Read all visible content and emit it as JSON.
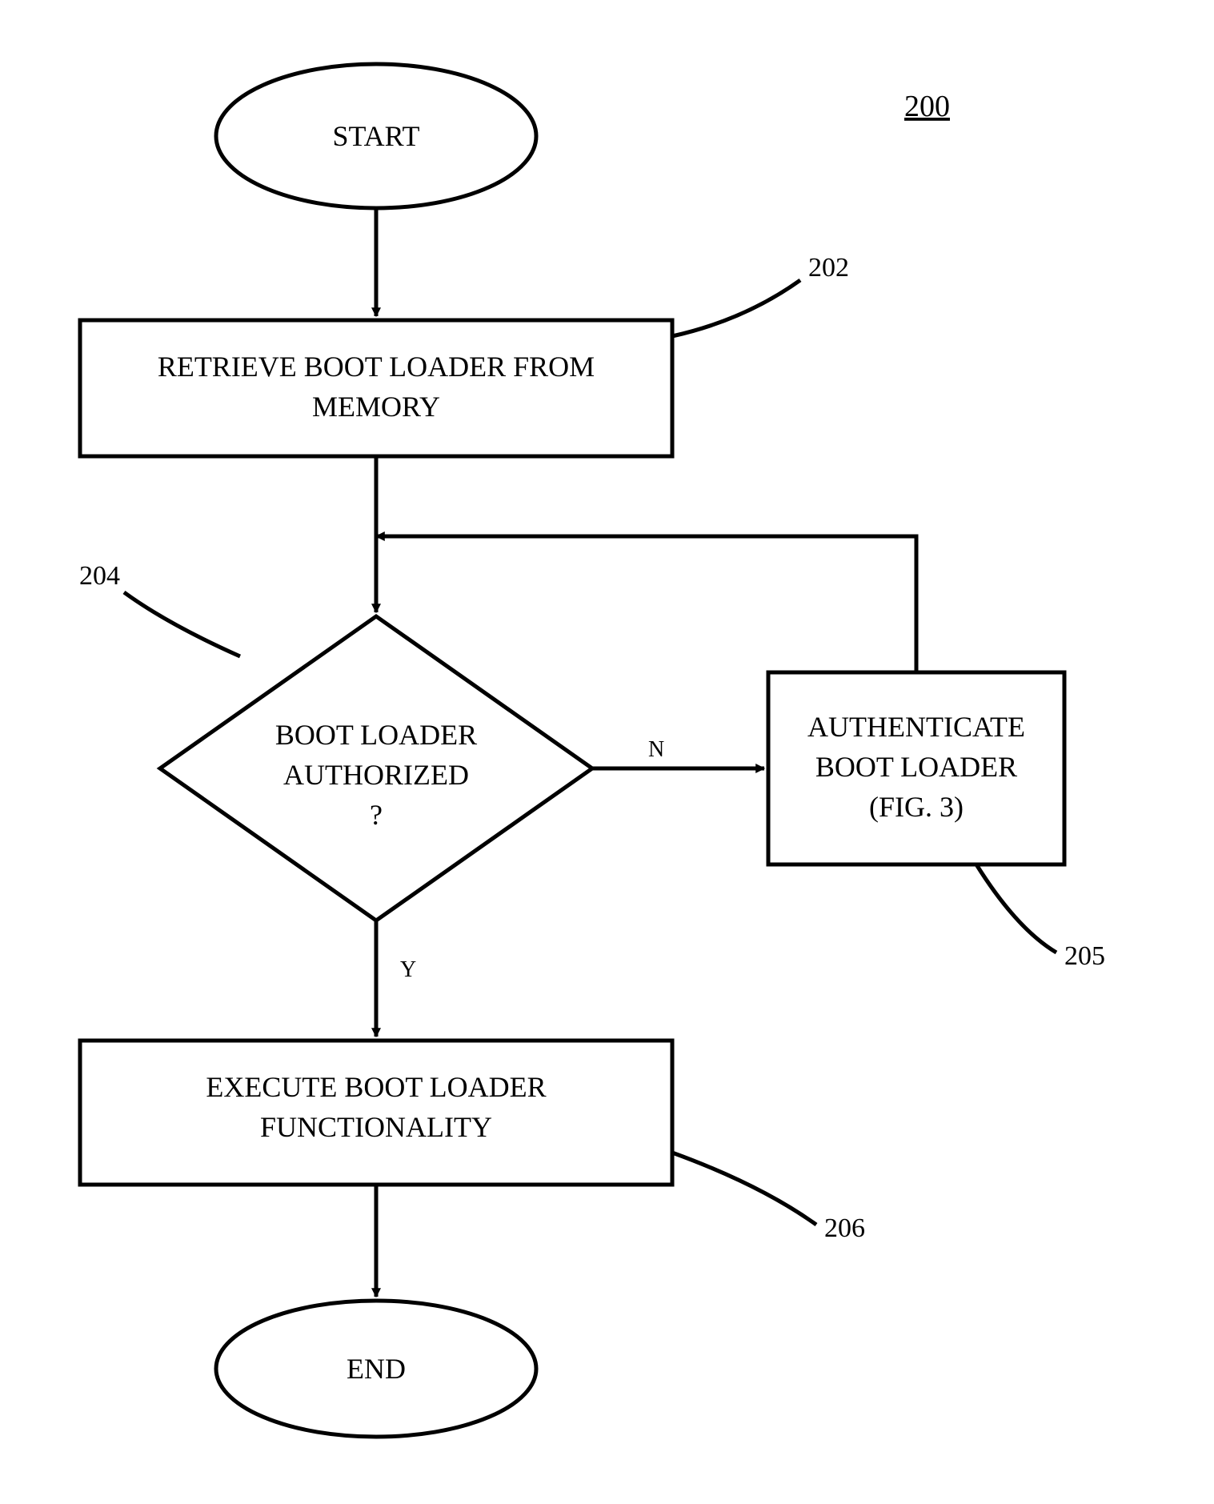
{
  "figure_number": "200",
  "start": {
    "label": "START"
  },
  "end": {
    "label": "END"
  },
  "step_retrieve": {
    "ref": "202",
    "line1": "RETRIEVE BOOT LOADER FROM",
    "line2": "MEMORY"
  },
  "decision_authorized": {
    "ref": "204",
    "line1": "BOOT LOADER",
    "line2": "AUTHORIZED",
    "line3": "?",
    "yes": "Y",
    "no": "N"
  },
  "step_authenticate": {
    "ref": "205",
    "line1": "AUTHENTICATE",
    "line2": "BOOT LOADER",
    "line3": "(FIG. 3)"
  },
  "step_execute": {
    "ref": "206",
    "line1": "EXECUTE BOOT LOADER",
    "line2": "FUNCTIONALITY"
  }
}
